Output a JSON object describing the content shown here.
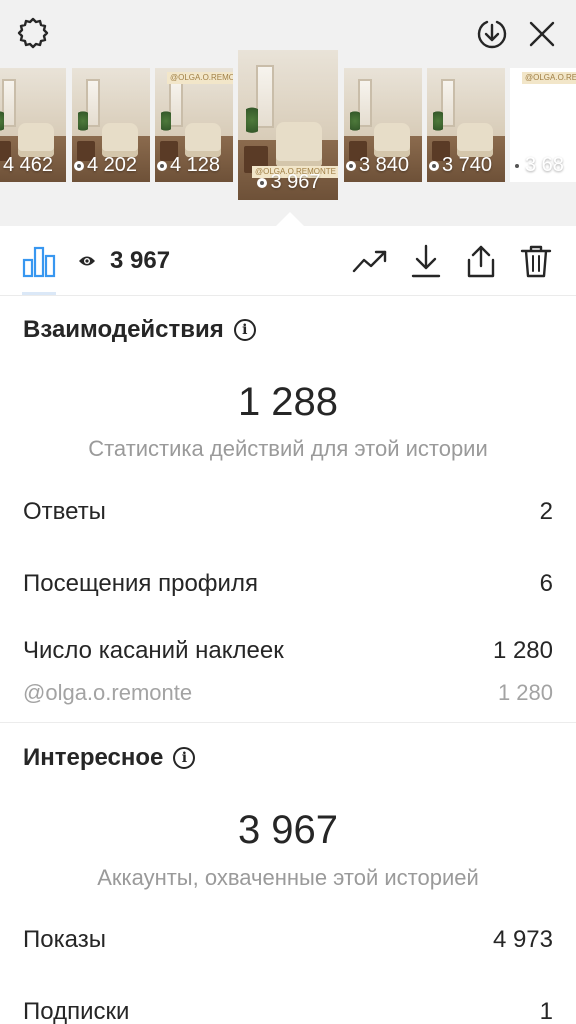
{
  "header": {
    "settings_icon": "gear-icon",
    "download_icon": "download-circle-icon",
    "close_icon": "close-icon"
  },
  "thumbnails": [
    {
      "views": "4 462",
      "sticker": ""
    },
    {
      "views": "4 202",
      "sticker": ""
    },
    {
      "views": "4 128",
      "sticker": "@OLGA.O.REMONTE"
    },
    {
      "views": "3 967",
      "sticker": "@OLGA.O.REMONTE",
      "selected": true
    },
    {
      "views": "3 840",
      "sticker": ""
    },
    {
      "views": "3 740",
      "sticker": ""
    },
    {
      "views": "3 68",
      "sticker": "@OLGA.O.REMONTE"
    }
  ],
  "toolbar": {
    "views": "3 967",
    "chart_icon": "bar-chart-icon",
    "eye_icon": "eye-icon",
    "promote_icon": "trending-up-icon",
    "save_icon": "download-icon",
    "share_icon": "share-icon",
    "delete_icon": "trash-icon"
  },
  "interactions": {
    "title": "Взаимодействия",
    "total": "1 288",
    "caption": "Статистика действий для этой истории",
    "rows": [
      {
        "label": "Ответы",
        "value": "2"
      },
      {
        "label": "Посещения профиля",
        "value": "6"
      },
      {
        "label": "Число касаний наклеек",
        "value": "1 280"
      }
    ],
    "sub_row": {
      "label": "@olga.o.remonte",
      "value": "1 280"
    }
  },
  "discovery": {
    "title": "Интересное",
    "total": "3 967",
    "caption": "Аккаунты, охваченные этой историей",
    "rows": [
      {
        "label": "Показы",
        "value": "4 973"
      },
      {
        "label": "Подписки",
        "value": "1"
      }
    ]
  },
  "colors": {
    "text": "#262626",
    "muted": "#9a9a9a",
    "accent": "#3897f0",
    "top_bg": "#f1f1f1"
  }
}
